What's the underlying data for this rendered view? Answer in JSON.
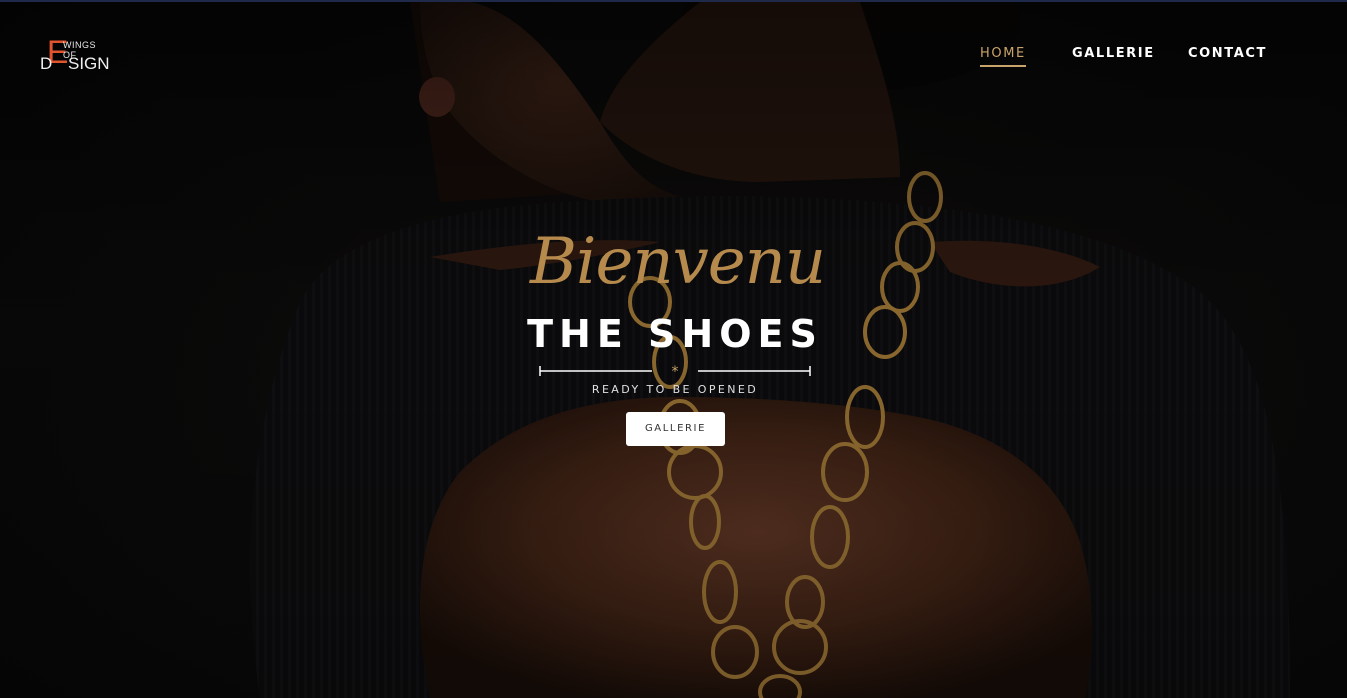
{
  "header": {
    "logo": {
      "big_letter": "E",
      "small_text": "WINGS OF",
      "left_letter": "D",
      "right_text": "SIGN",
      "accent_color": "#e0542e"
    },
    "nav": [
      {
        "label": "HOME",
        "active": true
      },
      {
        "label": "GALLERIE",
        "active": false
      },
      {
        "label": "CONTACT",
        "active": false
      }
    ]
  },
  "hero": {
    "script_text": "Bienvenu",
    "title": "THE SHOES",
    "subtitle": "READY TO BE OPENED",
    "button_label": "GALLERIE",
    "accent_color": "#c9a46a"
  }
}
